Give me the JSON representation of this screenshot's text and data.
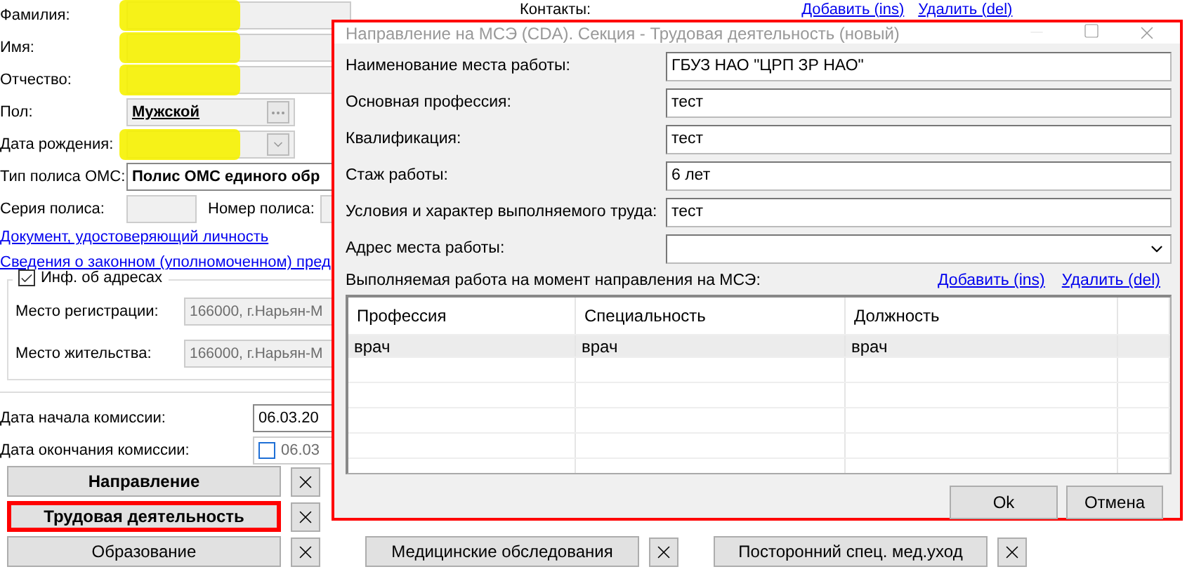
{
  "background_form": {
    "contacts_label": "Контакты:",
    "contacts_links": [
      "Добавить (ins)",
      "Удалить (del)"
    ],
    "fields": [
      {
        "label": "Фамилия:",
        "kind": "redacted"
      },
      {
        "label": "Имя:",
        "kind": "redacted"
      },
      {
        "label": "Отчество:",
        "kind": "redacted"
      },
      {
        "label": "Пол:",
        "kind": "picker",
        "value": "Мужской"
      },
      {
        "label": "Дата рождения:",
        "kind": "redacted-date"
      },
      {
        "label": "Тип полиса ОМС:",
        "kind": "bold",
        "value": "Полис ОМС единого обр"
      }
    ],
    "policy_series": {
      "label": "Серия полиса:"
    },
    "policy_number": {
      "label": "Номер полиса:"
    },
    "links": [
      "Документ, удостоверяющий личность",
      "Сведения о законном (уполномоченном) пред"
    ],
    "addresses": {
      "label": "Инф. об адресах",
      "checked": true,
      "rows": [
        {
          "label": "Место регистрации:",
          "value": "166000, г.Нарьян-М"
        },
        {
          "label": "Место жительства:",
          "value": "166000, г.Нарьян-М"
        }
      ]
    },
    "commission_start": {
      "label": "Дата начала комиссии:",
      "value": "06.03.20"
    },
    "commission_end": {
      "label": "Дата окончания комиссии:",
      "checked": false,
      "value": "06.03"
    },
    "section_buttons": [
      [
        {
          "label": "Направление",
          "filled": true,
          "selected": false
        },
        {
          "label": "Трудовая деятельность",
          "filled": true,
          "selected": true
        },
        {
          "label": "Образование",
          "filled": false,
          "selected": false
        }
      ],
      [
        {
          "label": "Медицинские обследования",
          "filled": false,
          "selected": false
        }
      ],
      [
        {
          "label": "Посторонний спец. мед.уход",
          "filled": false,
          "selected": false
        }
      ]
    ]
  },
  "dialog": {
    "title": "Направление на МСЭ (CDA). Секция - Трудовая деятельность (новый)",
    "fields": [
      {
        "label": "Наименование места работы:",
        "kind": "text",
        "value": "ГБУЗ НАО \"ЦРП ЗР НАО\""
      },
      {
        "label": "Основная профессия:",
        "kind": "text",
        "value": "тест"
      },
      {
        "label": "Квалификация:",
        "kind": "text",
        "value": "тест"
      },
      {
        "label": "Стаж работы:",
        "kind": "text",
        "value": "6 лет"
      },
      {
        "label": "Условия и характер выполняемого труда:",
        "kind": "text",
        "value": "тест"
      },
      {
        "label": "Адрес места работы:",
        "kind": "dropdown"
      }
    ],
    "work_label": "Выполняемая работа на момент направления на МСЭ:",
    "links": [
      "Добавить (ins)",
      "Удалить (del)"
    ],
    "table": {
      "columns": [
        "Профессия",
        "Специальность",
        "Должность"
      ],
      "rows": [
        {
          "cells": [
            "врач",
            "врач",
            "врач"
          ],
          "selected": true
        }
      ]
    },
    "buttons": [
      "Ok",
      "Отмена"
    ]
  }
}
